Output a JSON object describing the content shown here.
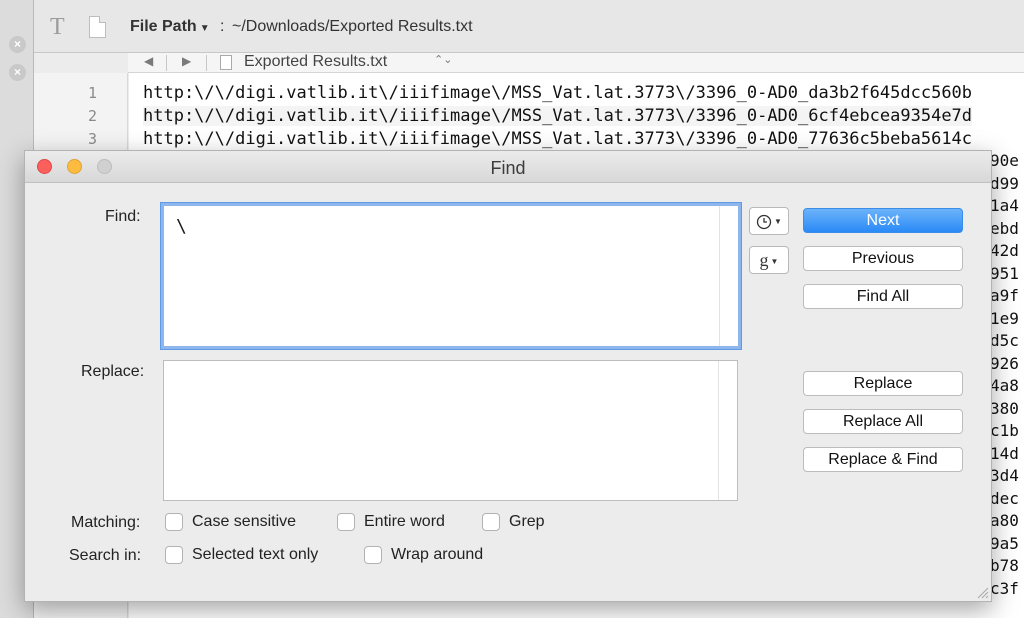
{
  "toolbar": {
    "text_tool_glyph": "T",
    "file_path_label": "File Path",
    "file_path_separator": ":",
    "file_path_value": "~/Downloads/Exported Results.txt"
  },
  "navbar": {
    "prev_glyph": "◀",
    "next_glyph": "▶",
    "filename": "Exported Results.txt",
    "updown_glyph": "⌃⌄"
  },
  "editor": {
    "line_numbers": [
      "1",
      "2",
      "3"
    ],
    "lines": [
      "http:\\/\\/digi.vatlib.it\\/iiifimage\\/MSS_Vat.lat.3773\\/3396_0-AD0_da3b2f645dcc560b",
      "http:\\/\\/digi.vatlib.it\\/iiifimage\\/MSS_Vat.lat.3773\\/3396_0-AD0_6cf4ebcea9354e7d",
      "http:\\/\\/digi.vatlib.it\\/iiifimage\\/MSS_Vat.lat.3773\\/3396_0-AD0_77636c5beba5614c"
    ],
    "visible_fragments": [
      "90e",
      "d99",
      "1a4",
      "ebd",
      "42d",
      "951",
      "a9f",
      "1e9",
      "d5c",
      "926",
      "4a8",
      "380",
      "c1b",
      "14d",
      "3d4",
      "dec",
      "a80",
      "9a5",
      "b78",
      "c3f"
    ]
  },
  "find_dialog": {
    "title": "Find",
    "find_label": "Find:",
    "find_value": "\\",
    "replace_label": "Replace:",
    "replace_value": "",
    "history_icon": "clock-icon",
    "grep_options_glyph": "g",
    "buttons": {
      "next": "Next",
      "previous": "Previous",
      "find_all": "Find All",
      "replace": "Replace",
      "replace_all": "Replace All",
      "replace_and_find": "Replace & Find"
    },
    "matching_label": "Matching:",
    "matching_options": {
      "case_sensitive": "Case sensitive",
      "entire_word": "Entire word",
      "grep": "Grep"
    },
    "search_in_label": "Search in:",
    "search_in_options": {
      "selected_text_only": "Selected text only",
      "wrap_around": "Wrap around"
    }
  },
  "colors": {
    "accent": "#2a8af6",
    "focus_ring": "#8fb6ec",
    "close": "#fc605c",
    "minimize": "#fdbc40"
  }
}
